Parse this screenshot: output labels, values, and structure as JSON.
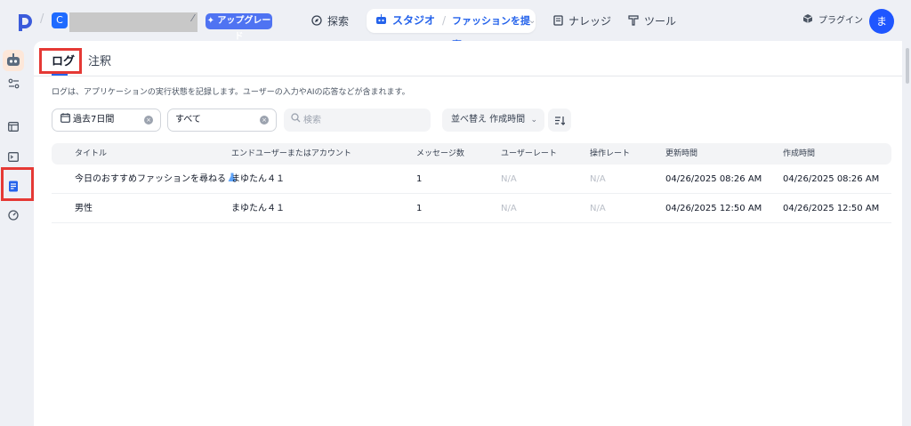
{
  "header": {
    "workspace_initial": "C",
    "upgrade_label": "✦ アップグレード",
    "nav": {
      "explore": "探索",
      "studio": "スタジオ",
      "app_name": "ファッションを提案",
      "knowledge": "ナレッジ",
      "tools": "ツール",
      "plugins": "プラグイン"
    },
    "user_initial": "ま"
  },
  "tabs": {
    "log": "ログ",
    "annotations": "注釈"
  },
  "description": "ログは、アプリケーションの実行状態を記録します。ユーザーの入力やAIの応答などが含まれます。",
  "filters": {
    "period_value": "過去7日間",
    "status_value": "すべて",
    "search_placeholder": "検索",
    "sort_label": "並べ替え 作成時間"
  },
  "table": {
    "columns": {
      "title": "タイトル",
      "user": "エンドユーザーまたはアカウント",
      "messages": "メッセージ数",
      "user_rate": "ユーザーレート",
      "op_rate": "操作レート",
      "updated": "更新時間",
      "created": "作成時間"
    },
    "rows": [
      {
        "title": "今日のおすすめファッションを尋ねる",
        "user": "まゆたん４１",
        "messages": "1",
        "user_rate": "N/A",
        "op_rate": "N/A",
        "updated": "04/26/2025 08:26 AM",
        "created": "04/26/2025 08:26 AM"
      },
      {
        "title": "男性",
        "user": "まゆたん４１",
        "messages": "1",
        "user_rate": "N/A",
        "op_rate": "N/A",
        "updated": "04/26/2025 12:50 AM",
        "created": "04/26/2025 12:50 AM"
      }
    ]
  },
  "colors": {
    "accent": "#2563eb",
    "highlight": "#e53935",
    "avatar": "#1f56ff"
  }
}
